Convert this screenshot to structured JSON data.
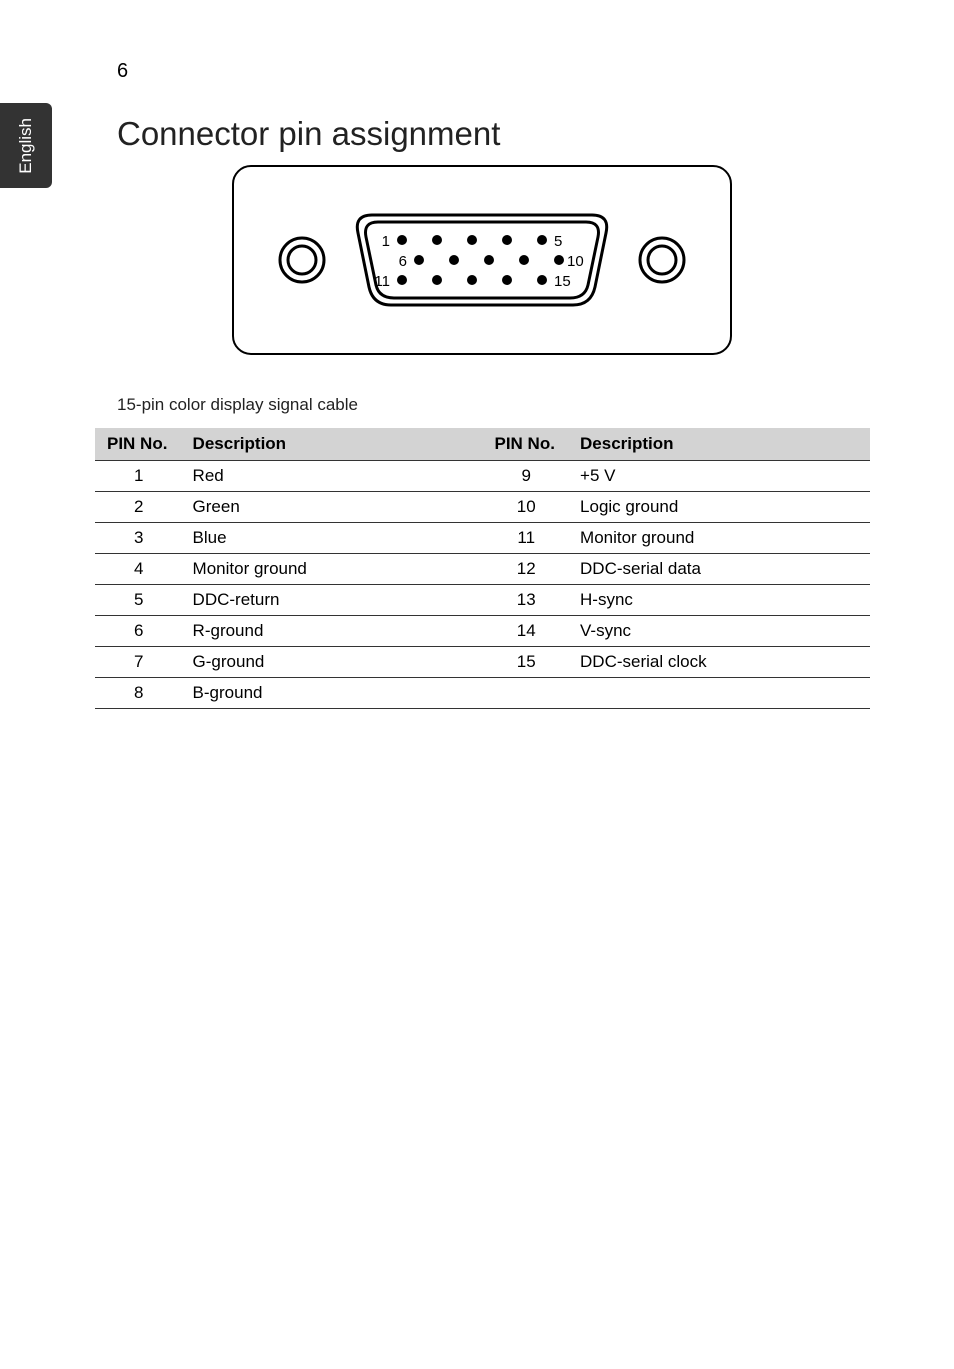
{
  "page_number": "6",
  "sidebar_label": "English",
  "title": "Connector pin assignment",
  "connector_labels": {
    "pin1": "1",
    "pin5": "5",
    "pin6": "6",
    "pin10": "10",
    "pin11": "11",
    "pin15": "15"
  },
  "subtitle": "15-pin color display signal cable",
  "table": {
    "headers": {
      "pin_no": "PIN No.",
      "description": "Description"
    },
    "rows": [
      {
        "left_pin": "1",
        "left_desc": "Red",
        "right_pin": "9",
        "right_desc": "+5 V"
      },
      {
        "left_pin": "2",
        "left_desc": "Green",
        "right_pin": "10",
        "right_desc": "Logic ground"
      },
      {
        "left_pin": "3",
        "left_desc": "Blue",
        "right_pin": "11",
        "right_desc": "Monitor ground"
      },
      {
        "left_pin": "4",
        "left_desc": "Monitor ground",
        "right_pin": "12",
        "right_desc": "DDC-serial data"
      },
      {
        "left_pin": "5",
        "left_desc": "DDC-return",
        "right_pin": "13",
        "right_desc": "H-sync"
      },
      {
        "left_pin": "6",
        "left_desc": "R-ground",
        "right_pin": "14",
        "right_desc": "V-sync"
      },
      {
        "left_pin": "7",
        "left_desc": "G-ground",
        "right_pin": "15",
        "right_desc": "DDC-serial clock"
      },
      {
        "left_pin": "8",
        "left_desc": "B-ground",
        "right_pin": "",
        "right_desc": ""
      }
    ]
  }
}
